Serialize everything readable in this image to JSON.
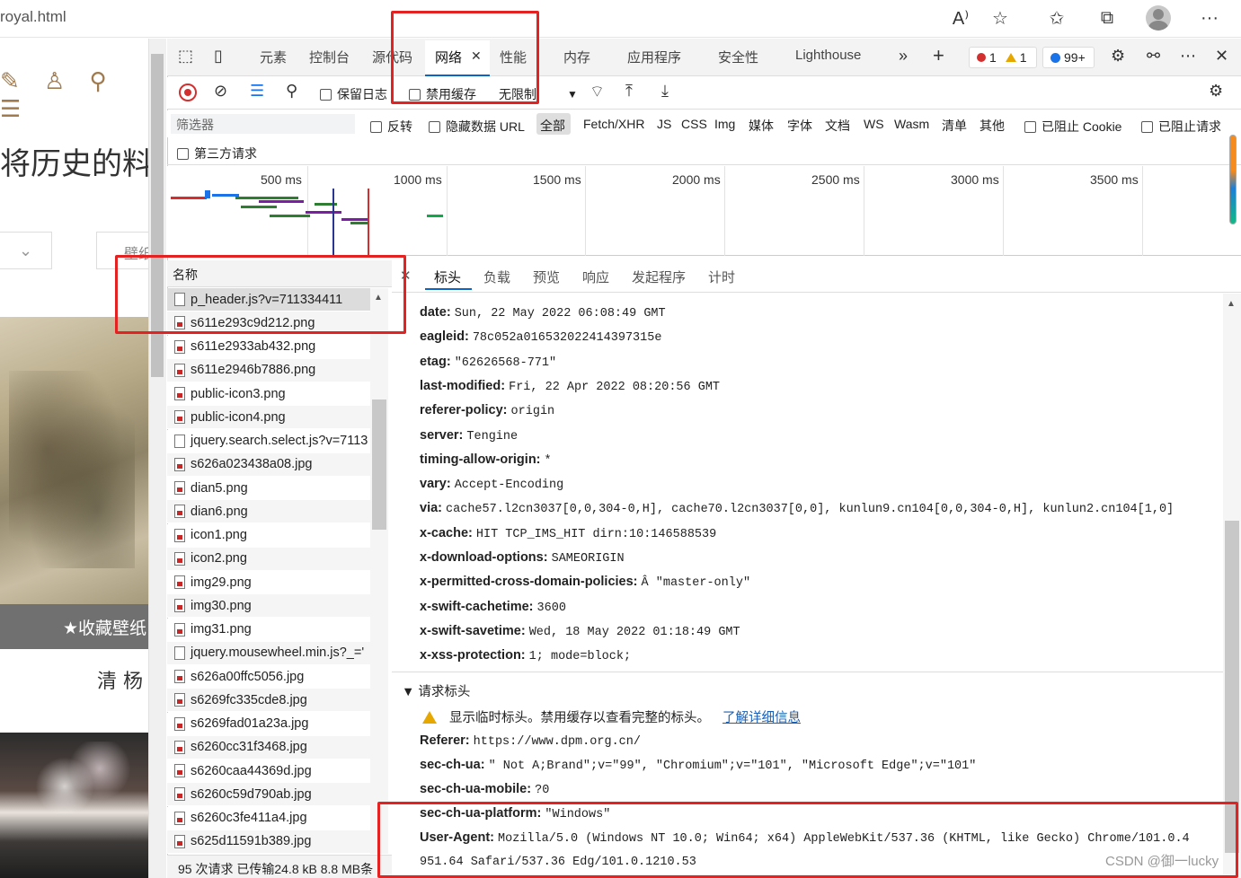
{
  "browser": {
    "url_fragment": "royal.html",
    "icons": [
      "read-aloud-icon",
      "add-favorite-icon",
      "favorites-icon",
      "collections-icon",
      "profile-avatar",
      "more-icon"
    ]
  },
  "page": {
    "heading": "将历史的料",
    "wallpaper_button": "壁纸",
    "collect_label": "★收藏壁纸",
    "caption": "清 杨"
  },
  "devtools": {
    "tabs": [
      "元素",
      "控制台",
      "源代码",
      "网络",
      "性能",
      "内存",
      "应用程序",
      "安全性",
      "Lighthouse"
    ],
    "active_tab": "网络",
    "error_count": "1",
    "warning_count": "1",
    "message_count": "99+",
    "toolbar": {
      "preserve_log": "保留日志",
      "disable_cache": "禁用缓存",
      "throttling": "无限制"
    },
    "filter": {
      "placeholder": "筛选器",
      "invert": "反转",
      "hide_data_urls": "隐藏数据 URL",
      "types": [
        "全部",
        "Fetch/XHR",
        "JS",
        "CSS",
        "Img",
        "媒体",
        "字体",
        "文档",
        "WS",
        "Wasm",
        "清单",
        "其他"
      ],
      "blocked_cookies": "已阻止 Cookie",
      "blocked_requests": "已阻止请求",
      "third_party": "第三方请求"
    },
    "timeline_ticks": [
      "500 ms",
      "1000 ms",
      "1500 ms",
      "2000 ms",
      "2500 ms",
      "3000 ms",
      "3500 ms"
    ],
    "list": {
      "header": "名称",
      "requests": [
        {
          "name": "p_header.js?v=711334411",
          "kind": "script",
          "selected": true
        },
        {
          "name": "s611e293c9d212.png",
          "kind": "image"
        },
        {
          "name": "s611e2933ab432.png",
          "kind": "image"
        },
        {
          "name": "s611e2946b7886.png",
          "kind": "image"
        },
        {
          "name": "public-icon3.png",
          "kind": "image"
        },
        {
          "name": "public-icon4.png",
          "kind": "image"
        },
        {
          "name": "jquery.search.select.js?v=7113",
          "kind": "script"
        },
        {
          "name": "s626a023438a08.jpg",
          "kind": "image"
        },
        {
          "name": "dian5.png",
          "kind": "image"
        },
        {
          "name": "dian6.png",
          "kind": "image"
        },
        {
          "name": "icon1.png",
          "kind": "image"
        },
        {
          "name": "icon2.png",
          "kind": "image"
        },
        {
          "name": "img29.png",
          "kind": "image"
        },
        {
          "name": "img30.png",
          "kind": "image"
        },
        {
          "name": "img31.png",
          "kind": "image"
        },
        {
          "name": "jquery.mousewheel.min.js?_='",
          "kind": "script"
        },
        {
          "name": "s626a00ffc5056.jpg",
          "kind": "image"
        },
        {
          "name": "s6269fc335cde8.jpg",
          "kind": "image"
        },
        {
          "name": "s6269fad01a23a.jpg",
          "kind": "image"
        },
        {
          "name": "s6260cc31f3468.jpg",
          "kind": "image"
        },
        {
          "name": "s6260caa44369d.jpg",
          "kind": "image"
        },
        {
          "name": "s6260c59d790ab.jpg",
          "kind": "image"
        },
        {
          "name": "s6260c3fe411a4.jpg",
          "kind": "image"
        },
        {
          "name": "s625d11591b389.jpg",
          "kind": "image"
        }
      ],
      "status": "95 次请求  已传输24.8 kB  8.8 MB条"
    },
    "detail_tabs": [
      "标头",
      "负载",
      "预览",
      "响应",
      "发起程序",
      "计时"
    ],
    "active_detail_tab": "标头",
    "response_headers": [
      {
        "key": "date:",
        "value": "Sun, 22 May 2022 06:08:49 GMT"
      },
      {
        "key": "eagleid:",
        "value": "78c052a016532022414397315e"
      },
      {
        "key": "etag:",
        "value": "\"62626568-771\""
      },
      {
        "key": "last-modified:",
        "value": "Fri, 22 Apr 2022 08:20:56 GMT"
      },
      {
        "key": "referer-policy:",
        "value": "origin"
      },
      {
        "key": "server:",
        "value": "Tengine"
      },
      {
        "key": "timing-allow-origin:",
        "value": "*"
      },
      {
        "key": "vary:",
        "value": "Accept-Encoding"
      },
      {
        "key": "via:",
        "value": "cache57.l2cn3037[0,0,304-0,H], cache70.l2cn3037[0,0], kunlun9.cn104[0,0,304-0,H], kunlun2.cn104[1,0]"
      },
      {
        "key": "x-cache:",
        "value": "HIT TCP_IMS_HIT dirn:10:146588539"
      },
      {
        "key": "x-download-options:",
        "value": "SAMEORIGIN"
      },
      {
        "key": "x-permitted-cross-domain-policies:",
        "value": "Â \"master-only\""
      },
      {
        "key": "x-swift-cachetime:",
        "value": "3600"
      },
      {
        "key": "x-swift-savetime:",
        "value": "Wed, 18 May 2022 01:18:49 GMT"
      },
      {
        "key": "x-xss-protection:",
        "value": "1; mode=block;"
      }
    ],
    "request_section": {
      "title": "▼ 请求标头",
      "warning": "显示临时标头。禁用缓存以查看完整的标头。",
      "learn_more": "了解详细信息",
      "headers": [
        {
          "key": "Referer:",
          "value": "https://www.dpm.org.cn/"
        },
        {
          "key": "sec-ch-ua:",
          "value": "\" Not A;Brand\";v=\"99\", \"Chromium\";v=\"101\", \"Microsoft Edge\";v=\"101\""
        },
        {
          "key": "sec-ch-ua-mobile:",
          "value": "?0"
        },
        {
          "key": "sec-ch-ua-platform:",
          "value": "\"Windows\""
        },
        {
          "key": "User-Agent:",
          "value": "Mozilla/5.0 (Windows NT 10.0; Win64; x64) AppleWebKit/537.36 (KHTML, like Gecko) Chrome/101.0.4"
        }
      ],
      "ua_continuation": "951.64 Safari/537.36 Edg/101.0.1210.53"
    }
  },
  "watermark": "CSDN @御一lucky",
  "colors": {
    "highlight": "#e52222",
    "accent": "#0a66c2"
  }
}
